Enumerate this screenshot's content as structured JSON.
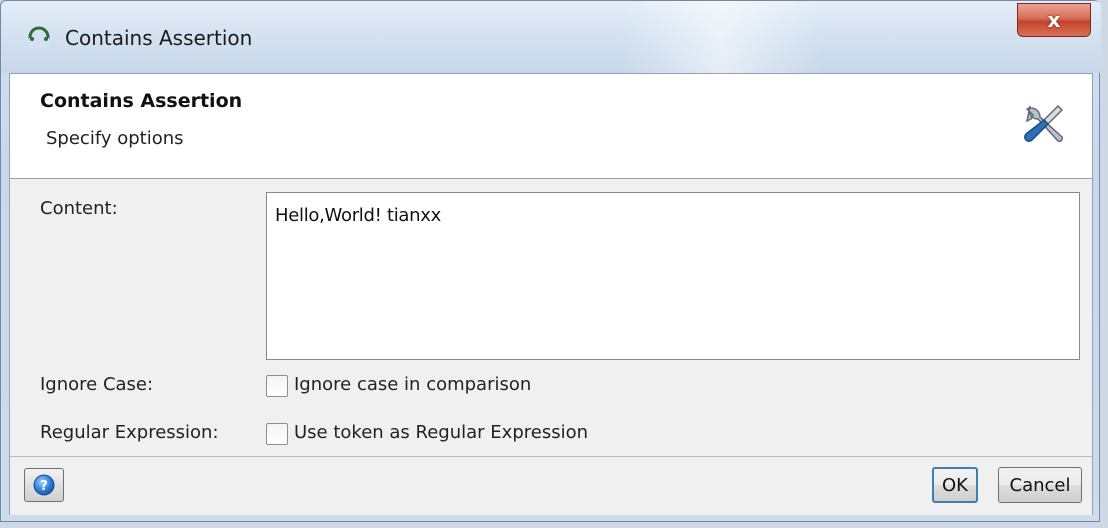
{
  "window": {
    "title": "Contains Assertion",
    "close_label": "x"
  },
  "header": {
    "title": "Contains Assertion",
    "subtitle": "Specify options",
    "icon": "tools-icon"
  },
  "form": {
    "content_label": "Content:",
    "content_value": "Hello,World! tianxx",
    "ignore_case_label": "Ignore Case:",
    "ignore_case_option": "Ignore case in comparison",
    "ignore_case_checked": false,
    "regex_label": "Regular Expression:",
    "regex_option": "Use token as Regular Expression",
    "regex_checked": false
  },
  "footer": {
    "help_icon": "help-icon",
    "ok_label": "OK",
    "cancel_label": "Cancel"
  },
  "colors": {
    "accent": "#3c7fb1",
    "close": "#c4442a"
  }
}
